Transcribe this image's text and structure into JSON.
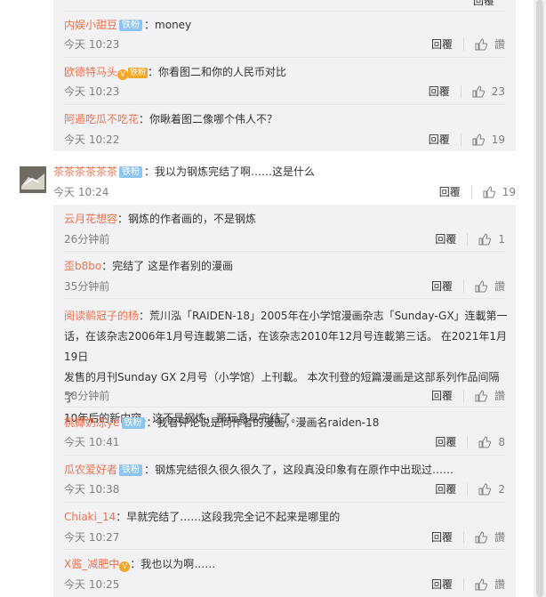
{
  "labels": {
    "reply": "回覆",
    "zan": "讚"
  },
  "sub_comments_top": [
    {
      "user": "内娱小甜豆",
      "badge": "铁粉",
      "vip": false,
      "text": "money",
      "time": "今天 10:23",
      "likes": ""
    },
    {
      "user": "欧德特马头",
      "badge": "铁粉",
      "vip": true,
      "text": "你看图二和你的人民币对比",
      "time": "今天 10:23",
      "likes": "23"
    },
    {
      "user": "阿遁吃瓜不吃花",
      "badge": "",
      "vip": false,
      "text": "你瞅着图二像哪个伟人不？",
      "time": "今天 10:22",
      "likes": "19"
    }
  ],
  "main_comment": {
    "user": "茶茶茶茶茶茶",
    "badge": "铁粉",
    "text": "我以为钢炼完结了啊……这是什么",
    "time": "今天 10:24",
    "likes": "19"
  },
  "sub_comments": [
    {
      "user": "云月花想容",
      "badge": "",
      "vip": false,
      "text": "钢炼的作者画的，不是钢炼",
      "time": "26分钟前",
      "likes": "1"
    },
    {
      "user": "歪b8bo",
      "badge": "",
      "vip": false,
      "text": "完结了 这是作者别的漫画",
      "time": "35分钟前",
      "likes": ""
    },
    {
      "user": "阅读鹡冠子的杨",
      "badge": "",
      "vip": false,
      "text": "荒川泓「RAIDEN-18」2005年在小学馆漫画杂志「Sunday-GX」连載第一",
      "text2": "话，在该杂志2006年1月号连載第二话，在该杂志2010年12月号连載第三话。 在2021年1月19日",
      "text3": "发售的月刊Sunday GX 2月号（小学馆）上刊載。 本次刊登的短篇漫画是这部系列作品间隔了",
      "text4": "10年后的新内容。这不是钢炼，那玩意早完结了。",
      "time": "58分钟前",
      "likes": ""
    },
    {
      "user": "桃椰奶冻ye",
      "badge": "铁粉",
      "vip": false,
      "text": "我看评论说是同作者的漫画，漫画名raiden-18",
      "time": "今天 10:41",
      "likes": "8"
    },
    {
      "user": "瓜农爱好者",
      "badge": "铁粉",
      "vip": false,
      "text": "钢炼完结很久很久很久了，这段真没印象有在原作中出现过……",
      "time": "今天 10:38",
      "likes": "2"
    },
    {
      "user": "Chiaki_14",
      "badge": "",
      "vip": false,
      "text": "早就完结了……这段我完全记不起来是哪里的",
      "time": "今天 10:27",
      "likes": ""
    },
    {
      "user": "X酱_减肥中",
      "badge": "",
      "vip": true,
      "text": "我也以为啊……",
      "time": "今天 10:25",
      "likes": ""
    }
  ],
  "colors": {
    "username": "#eb7350",
    "badge": "#8ec5f0",
    "subbg": "#f2f2f5"
  }
}
